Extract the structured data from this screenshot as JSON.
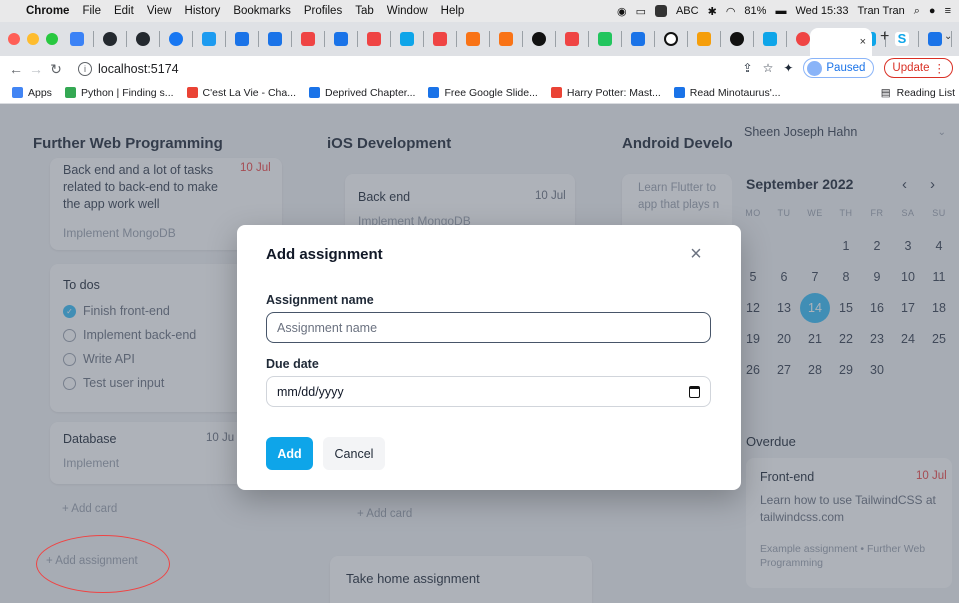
{
  "menubar": {
    "apple": "",
    "items": [
      "Chrome",
      "File",
      "Edit",
      "View",
      "History",
      "Bookmarks",
      "Profiles",
      "Tab",
      "Window",
      "Help"
    ],
    "status": {
      "abc": "ABC",
      "battery": "81%",
      "datetime": "Wed 15:33",
      "user": "Tran Tran"
    }
  },
  "browser": {
    "tab_close": "×",
    "new_tab": "+",
    "url": "localhost:5174",
    "profile_label": "Paused",
    "update_label": "Update",
    "bookmarks": [
      {
        "label": "Apps",
        "color": "#4285f4"
      },
      {
        "label": "Python | Finding s...",
        "color": "#34a853"
      },
      {
        "label": "C'est La Vie - Cha...",
        "color": "#ea4335"
      },
      {
        "label": "Deprived Chapter...",
        "color": "#1a73e8"
      },
      {
        "label": "Free Google Slide...",
        "color": "#1a73e8"
      },
      {
        "label": "Harry Potter: Mast...",
        "color": "#ea4335"
      },
      {
        "label": "Read Minotaurus'...",
        "color": "#1a73e8"
      }
    ],
    "reading_list": "Reading List"
  },
  "board": {
    "columns": [
      {
        "title": "Further Web Programming",
        "card1": {
          "desc": "Back end and a lot of tasks related to back-end to make the app work well",
          "date": "10 Jul",
          "sub": "Implement MongoDB"
        },
        "todos": {
          "title": "To dos",
          "items": [
            {
              "label": "Finish front-end",
              "done": true
            },
            {
              "label": "Implement back-end",
              "done": false
            },
            {
              "label": "Write API",
              "done": false
            },
            {
              "label": "Test user input",
              "done": false
            }
          ]
        },
        "card3": {
          "title": "Database",
          "date": "10 Ju",
          "sub": "Implement"
        },
        "add_card": "+ Add card",
        "add_assignment": "+ Add assignment"
      },
      {
        "title": "iOS Development",
        "card1": {
          "title": "Back end",
          "date": "10 Jul",
          "sub": "Implement MongoDB"
        },
        "add_card": "+ Add card",
        "next_title": "Take home assignment"
      },
      {
        "title": "Android Develo",
        "card1": {
          "desc": "Learn Flutter to app that plays n"
        }
      }
    ]
  },
  "sidebar": {
    "user": "Sheen Joseph Hahn",
    "calendar": {
      "month": "September 2022",
      "prev": "‹",
      "next": "›",
      "weekdays": [
        "MO",
        "TU",
        "WE",
        "TH",
        "FR",
        "SA",
        "SU"
      ],
      "rows": [
        [
          "",
          "",
          "",
          "1",
          "2",
          "3",
          "4"
        ],
        [
          "5",
          "6",
          "7",
          "8",
          "9",
          "10",
          "11"
        ],
        [
          "12",
          "13",
          "14",
          "15",
          "16",
          "17",
          "18"
        ],
        [
          "19",
          "20",
          "21",
          "22",
          "23",
          "24",
          "25"
        ],
        [
          "26",
          "27",
          "28",
          "29",
          "30",
          "",
          ""
        ]
      ],
      "today": "14"
    },
    "overdue": {
      "title": "Overdue",
      "card": {
        "title": "Front-end",
        "date": "10 Jul",
        "desc": "Learn how to use TailwindCSS at tailwindcss.com",
        "meta": "Example assignment • Further Web Programming"
      }
    }
  },
  "modal": {
    "title": "Add assignment",
    "close": "×",
    "name_label": "Assignment name",
    "name_placeholder": "Assignment name",
    "name_value": "",
    "date_label": "Due date",
    "date_value": "mm/dd/yyyy",
    "add_label": "Add",
    "cancel_label": "Cancel"
  },
  "colors": {
    "accent": "#0ea5e9",
    "today": "#38bdf8",
    "overdue_date": "#ef4444",
    "annotation": "#ef4444"
  }
}
